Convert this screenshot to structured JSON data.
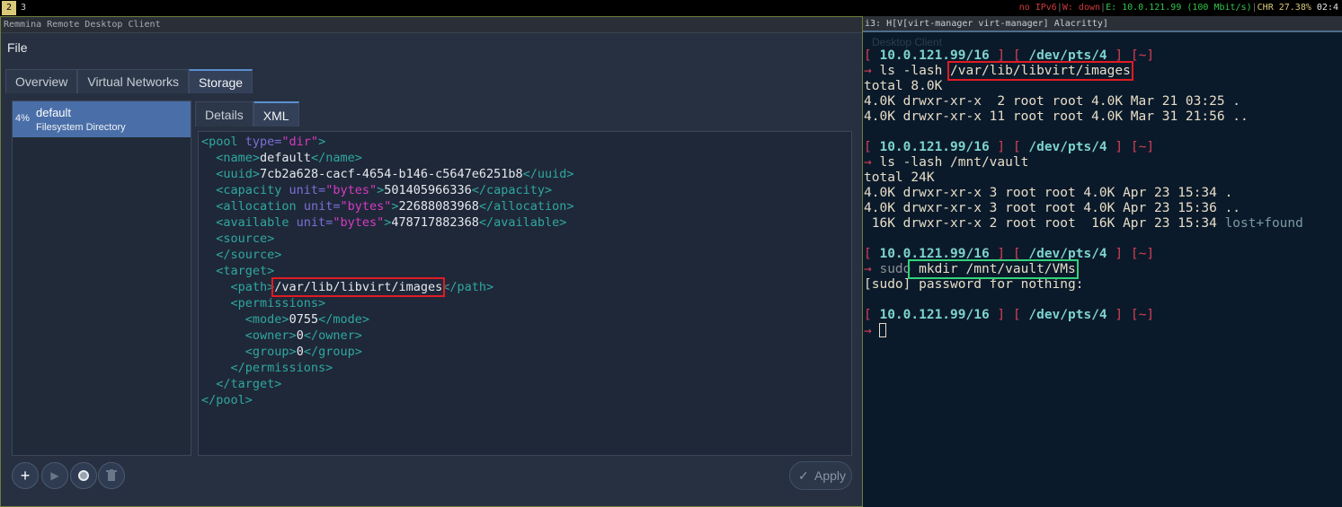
{
  "topbar": {
    "workspaces": [
      "2",
      "3"
    ],
    "status": {
      "ipv6": "no IPv6",
      "wifi": "W: down",
      "ethernet": "E: 10.0.121.99 (100 Mbit/s)",
      "battery": "CHR 27.38%",
      "time": "02:4"
    }
  },
  "left_window": {
    "title": "Remmina Remote Desktop Client",
    "menu": "File",
    "tabs": [
      "Overview",
      "Virtual Networks",
      "Storage"
    ],
    "pool": {
      "pct": "4%",
      "name": "default",
      "type": "Filesystem Directory"
    },
    "inner_tabs": [
      "Details",
      "XML"
    ],
    "xml": {
      "l1_open": "<pool ",
      "l1_attr": "type=",
      "l1_val": "\"dir\"",
      "l1_close": ">",
      "l2_open": "<name>",
      "l2_text": "default",
      "l2_close": "</name>",
      "l3_open": "<uuid>",
      "l3_text": "7cb2a628-cacf-4654-b146-c5647e6251b8",
      "l3_close": "</uuid>",
      "l4_open": "<capacity ",
      "l4_attr": "unit=",
      "l4_val": "\"bytes\"",
      "l4_gt": ">",
      "l4_text": "501405966336",
      "l4_close": "</capacity>",
      "l5_open": "<allocation ",
      "l5_attr": "unit=",
      "l5_val": "\"bytes\"",
      "l5_gt": ">",
      "l5_text": "22688083968",
      "l5_close": "</allocation>",
      "l6_open": "<available ",
      "l6_attr": "unit=",
      "l6_val": "\"bytes\"",
      "l6_gt": ">",
      "l6_text": "478717882368",
      "l6_close": "</available>",
      "l7": "<source>",
      "l8": "</source>",
      "l9": "<target>",
      "l10_open": "<path>",
      "l10_text": "/var/lib/libvirt/images",
      "l10_close": "</path>",
      "l11": "<permissions>",
      "l12_open": "<mode>",
      "l12_text": "0755",
      "l12_close": "</mode>",
      "l13_open": "<owner>",
      "l13_text": "0",
      "l13_close": "</owner>",
      "l14_open": "<group>",
      "l14_text": "0",
      "l14_close": "</group>",
      "l15": "</permissions>",
      "l16": "</target>",
      "l17": "</pool>"
    },
    "apply_label": "Apply"
  },
  "terminal": {
    "title": "i3: H[V[virt-manager virt-manager] Alacritty]",
    "ghost": "Desktop Client",
    "prompt_ip": "10.0.121.99/16",
    "prompt_tty": "/dev/pts/4",
    "prompt_dir": "[~]",
    "cmd1_a": "ls -lash ",
    "cmd1_b": "/var/lib/libvirt/images",
    "out1": [
      "total 8.0K",
      "4.0K drwxr-xr-x  2 root root 4.0K Mar 21 03:25 .",
      "4.0K drwxr-xr-x 11 root root 4.0K Mar 31 21:56 .."
    ],
    "cmd2": "ls -lash /mnt/vault",
    "out2": [
      "total 24K",
      "4.0K drwxr-xr-x 3 root root 4.0K Apr 23 15:34 .",
      "4.0K drwxr-xr-x 3 root root 4.0K Apr 23 15:36 .."
    ],
    "out2_last_a": " 16K drwxr-xr-x 2 root root  16K Apr 23 15:34 ",
    "out2_last_b": "lost+found",
    "cmd3_a": "sudo",
    "cmd3_b": " mkdir /mnt/vault/VMs",
    "out3": "[sudo] password for nothing:"
  }
}
